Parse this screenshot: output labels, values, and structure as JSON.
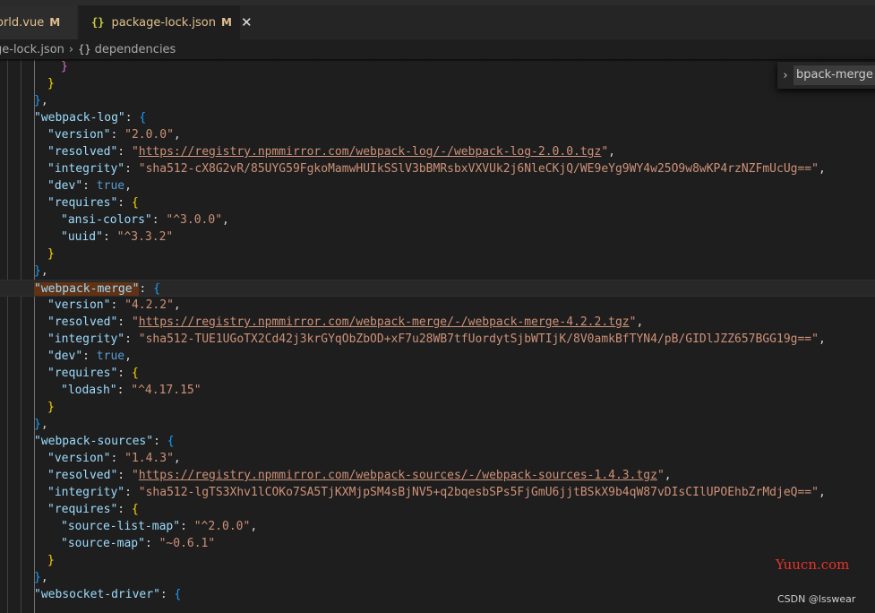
{
  "tabs": [
    {
      "filename": "orld.vue",
      "status": "M"
    },
    {
      "filename": "package-lock.json",
      "status": "M",
      "icon": "{}"
    }
  ],
  "breadcrumb": {
    "file": "ge-lock.json",
    "icon": "{}",
    "symbol": "dependencies"
  },
  "find_widget": {
    "query": "bpack-merge",
    "after": " A"
  },
  "watermark": "Yuucn.com",
  "credit": "CSDN @lsswear",
  "colors": {
    "key": "#9cdcfe",
    "string": "#ce9178",
    "bool": "#569cd6",
    "bracket_gold": "#ffd700",
    "bracket_purple": "#da70d6",
    "bracket_blue": "#179fff",
    "find_match": "#613214"
  },
  "code": {
    "true": "true",
    "webpack_log": {
      "name": "webpack-log",
      "version": "2.0.0",
      "resolved": "https://registry.npmmirror.com/webpack-log/-/webpack-log-2.0.0.tgz",
      "integrity": "sha512-cX8G2vR/85UYG59FgkoMamwHUIkSSlV3bBMRsbxVXVUk2j6NleCKjQ/WE9eYg9WY4w25O9w8wKP4rzNZFmUcUg==",
      "req_1_name": "ansi-colors",
      "req_1_val": "^3.0.0",
      "req_2_name": "uuid",
      "req_2_val": "^3.3.2"
    },
    "webpack_merge": {
      "name": "webpack-merge",
      "version": "4.2.2",
      "resolved": "https://registry.npmmirror.com/webpack-merge/-/webpack-merge-4.2.2.tgz",
      "integrity": "sha512-TUE1UGoTX2Cd42j3krGYqObZbOD+xF7u28WB7tfUordytSjbWTIjK/8V0amkBfTYN4/pB/GIDlJZZ657BGG19g==",
      "req_1_name": "lodash",
      "req_1_val": "^4.17.15"
    },
    "webpack_sources": {
      "name": "webpack-sources",
      "version": "1.4.3",
      "resolved": "https://registry.npmmirror.com/webpack-sources/-/webpack-sources-1.4.3.tgz",
      "integrity": "sha512-lgTS3Xhv1lCOKo7SA5TjKXMjpSM4sBjNV5+q2bqesbSPs5FjGmU6jjtBSkX9b4qW87vDIsCIlUPOEhbZrMdjeQ==",
      "req_1_name": "source-list-map",
      "req_1_val": "^2.0.0",
      "req_2_name": "source-map",
      "req_2_val": "~0.6.1"
    },
    "websocket_driver": {
      "name": "websocket-driver"
    },
    "keys": {
      "version": "version",
      "resolved": "resolved",
      "integrity": "integrity",
      "dev": "dev",
      "requires": "requires"
    }
  }
}
